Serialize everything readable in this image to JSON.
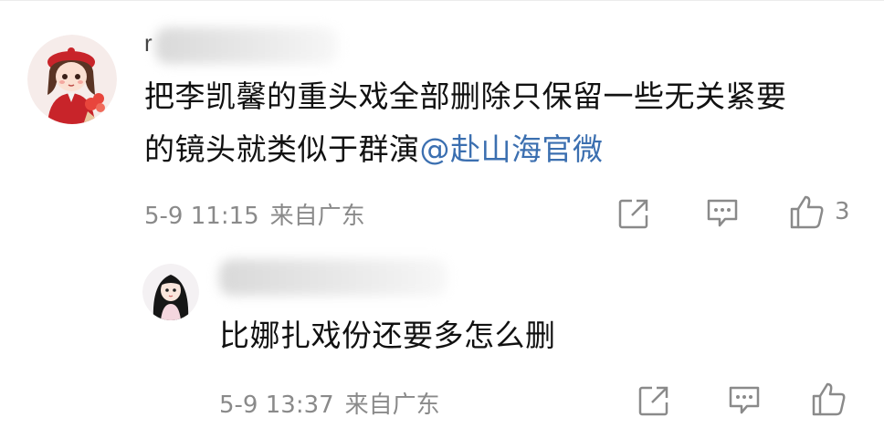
{
  "comment": {
    "author_initial": "r",
    "text_line1": "把李凯馨的重头戏全部删除只保留一些无关紧要",
    "text_line2": "的镜头就类似于群演",
    "mention": "@赴山海官微",
    "date": "5-9 11:15",
    "location": "来自广东",
    "like_count": "3",
    "icons": [
      "share-icon",
      "comment-icon",
      "like-icon"
    ]
  },
  "reply": {
    "text": "比娜扎戏份还要多怎么删",
    "date": "5-9 13:37",
    "location": "来自广东",
    "icons": [
      "share-icon",
      "comment-icon",
      "like-icon"
    ]
  },
  "colors": {
    "text": "#111111",
    "meta": "#8a8a8a",
    "mention": "#3b6fb0",
    "avatar_red": "#c8242a"
  }
}
